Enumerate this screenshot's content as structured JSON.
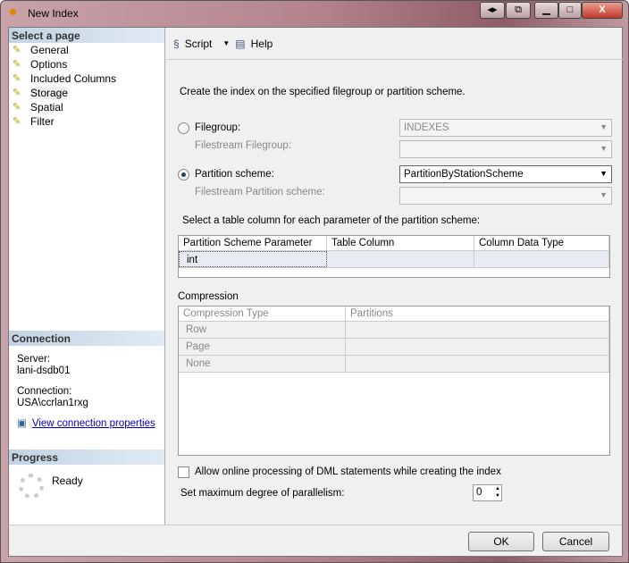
{
  "window": {
    "title": "New Index"
  },
  "sidebar": {
    "header": "Select a page",
    "items": [
      {
        "label": "General"
      },
      {
        "label": "Options"
      },
      {
        "label": "Included Columns"
      },
      {
        "label": "Storage"
      },
      {
        "label": "Spatial"
      },
      {
        "label": "Filter"
      }
    ],
    "selected": "Storage"
  },
  "connection": {
    "header": "Connection",
    "server_label": "Server:",
    "server": "lani-dsdb01",
    "connection_label": "Connection:",
    "connection": "USA\\ccrlan1rxg",
    "link": "View connection properties"
  },
  "progress": {
    "header": "Progress",
    "status": "Ready"
  },
  "toolbar": {
    "script": "Script",
    "help": "Help"
  },
  "storage": {
    "intro": "Create the index on the specified filegroup or partition scheme.",
    "filegroup_label": "Filegroup:",
    "filegroup_value": "INDEXES",
    "filestream_filegroup_label": "Filestream Filegroup:",
    "partition_label": "Partition scheme:",
    "partition_value": "PartitionByStationScheme",
    "filestream_partition_label": "Filestream Partition scheme:",
    "selected_option": "partition",
    "param_prompt": "Select a table column for each parameter of the partition scheme:",
    "param_headers": [
      "Partition Scheme Parameter",
      "Table Column",
      "Column Data Type"
    ],
    "param_rows": [
      [
        "int",
        "",
        ""
      ]
    ],
    "compression_label": "Compression",
    "compression_headers": [
      "Compression Type",
      "Partitions"
    ],
    "compression_rows": [
      [
        "Row",
        ""
      ],
      [
        "Page",
        ""
      ],
      [
        "None",
        ""
      ]
    ],
    "online_label": "Allow online processing of DML statements while creating the index",
    "online_checked": false,
    "maxdop_label": "Set maximum degree of parallelism:",
    "maxdop_value": "0"
  },
  "buttons": {
    "ok": "OK",
    "cancel": "Cancel"
  }
}
